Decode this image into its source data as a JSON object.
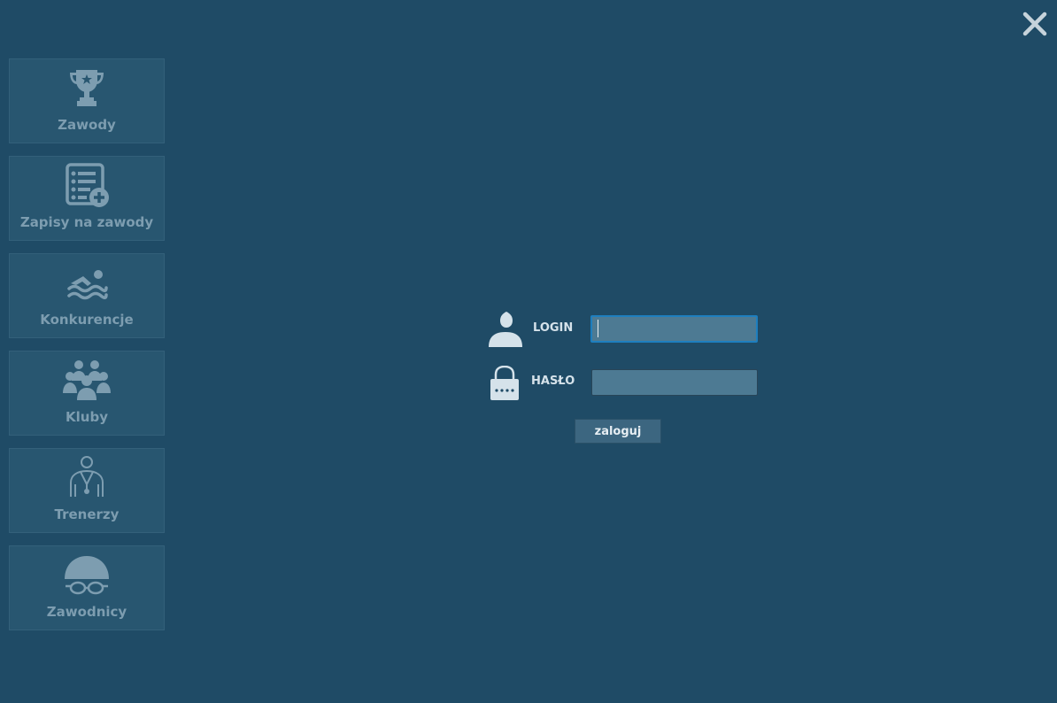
{
  "window": {
    "close_icon": "close-icon"
  },
  "sidebar": {
    "items": [
      {
        "label": "Zawody",
        "icon": "trophy-icon"
      },
      {
        "label": "Zapisy na zawody",
        "icon": "list-add-icon"
      },
      {
        "label": "Konkurencje",
        "icon": "swimmer-icon"
      },
      {
        "label": "Kluby",
        "icon": "group-icon"
      },
      {
        "label": "Trenerzy",
        "icon": "coach-icon"
      },
      {
        "label": "Zawodnicy",
        "icon": "swim-cap-goggles-icon"
      }
    ]
  },
  "login_form": {
    "login_label": "LOGIN",
    "login_value": "",
    "password_label": "HASŁO",
    "password_value": "",
    "submit_label": "zaloguj",
    "login_icon": "user-icon",
    "password_icon": "padlock-icon"
  },
  "colors": {
    "background": "#1f4b66",
    "sidebar_tile": "#285670",
    "icon": "#7d9db0",
    "input": "#4d7a93",
    "focus_border": "#1e7fbf"
  }
}
